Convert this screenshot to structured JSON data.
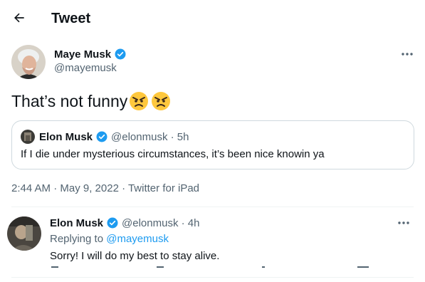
{
  "header": {
    "title": "Tweet",
    "back_icon": "arrow-left-icon"
  },
  "tweet": {
    "author_name": "Maye Musk",
    "author_handle": "@mayemusk",
    "text": "That’s not funny",
    "emojis": [
      "angry-face-icon",
      "angry-face-icon"
    ],
    "timestamp": "2:44 AM · May 9, 2022 · Twitter for iPad",
    "quoted": {
      "author_name": "Elon Musk",
      "author_meta": "@elonmusk · 5h",
      "text": "If I die under mysterious circumstances, it’s been nice knowin ya"
    }
  },
  "reply": {
    "author_name": "Elon Musk",
    "author_meta": "@elonmusk · 4h",
    "replying_prefix": "Replying to",
    "replying_handle": "@mayemusk",
    "text": "Sorry! I will do my best to stay alive."
  },
  "colors": {
    "accent": "#1d9bf0",
    "muted": "#536471",
    "border": "#cfd9de",
    "emoji": "#ffc83d"
  }
}
